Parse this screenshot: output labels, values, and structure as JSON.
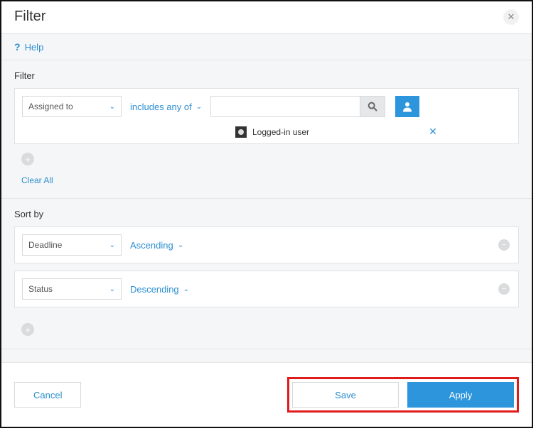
{
  "dialog": {
    "title": "Filter"
  },
  "help": {
    "label": "Help"
  },
  "filter": {
    "section_label": "Filter",
    "field_label": "Assigned to",
    "operator_label": "includes any of",
    "search_value": "",
    "search_placeholder": "",
    "chip_label": "Logged-in user",
    "clear_all_label": "Clear All"
  },
  "sort": {
    "section_label": "Sort by",
    "rows": [
      {
        "field": "Deadline",
        "direction": "Ascending"
      },
      {
        "field": "Status",
        "direction": "Descending"
      }
    ]
  },
  "footer": {
    "cancel_label": "Cancel",
    "save_label": "Save",
    "apply_label": "Apply"
  },
  "colors": {
    "accent": "#2c95dc",
    "highlight": "#e01b1b"
  }
}
